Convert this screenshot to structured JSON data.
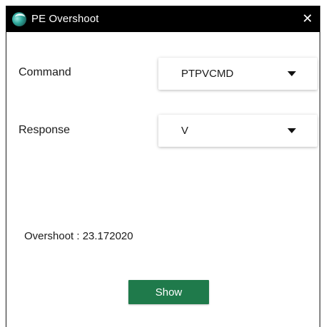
{
  "window": {
    "title": "PE Overshoot",
    "close_glyph": "✕",
    "app_icon": "app-logo-icon"
  },
  "command": {
    "label": "Command",
    "selected": "PTPVCMD"
  },
  "response": {
    "label": "Response",
    "selected": "V"
  },
  "result": {
    "text": "Overshoot : 23.172020"
  },
  "actions": {
    "show_label": "Show"
  },
  "colors": {
    "titlebar": "#000000",
    "button": "#1f7a4b",
    "button_text": "#ffffff"
  }
}
